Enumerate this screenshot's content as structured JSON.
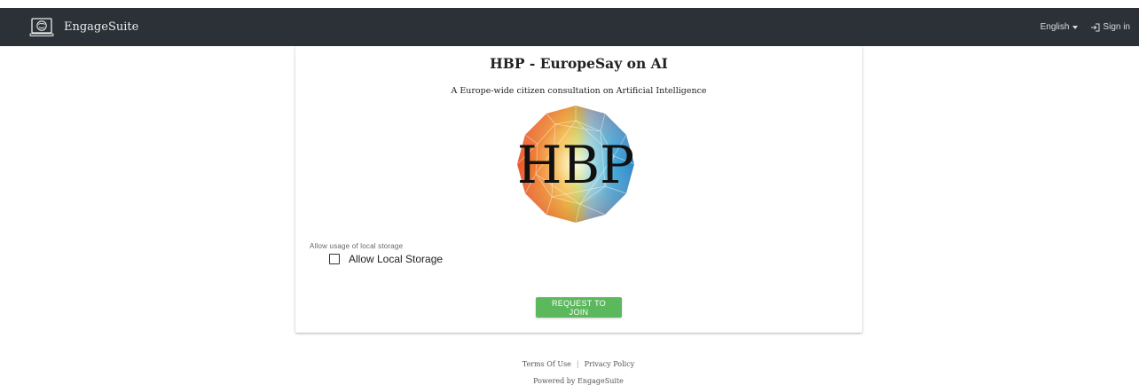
{
  "navbar": {
    "brand_name": "EngageSuite",
    "language_label": "English",
    "signin_label": "Sign in"
  },
  "card": {
    "title": "HBP - EuropeSay on AI",
    "subtitle": "A Europe-wide citizen consultation on Artificial Intelligence",
    "logo_text": "HBP",
    "storage_label": "Allow usage of local storage",
    "checkbox_label": "Allow Local Storage",
    "checkbox_checked": false,
    "join_button": "REQUEST TO JOIN"
  },
  "footer": {
    "terms": "Terms Of Use",
    "separator": "|",
    "privacy": "Privacy Policy",
    "powered_by": "Powered by EngageSuite"
  },
  "colors": {
    "navbar_bg": "#2b3136",
    "join_button_bg": "#5cb85c"
  },
  "icons": {
    "brand": "engagesuite-logo-icon",
    "language_caret": "caret-down-icon",
    "signin": "sign-in-icon"
  }
}
